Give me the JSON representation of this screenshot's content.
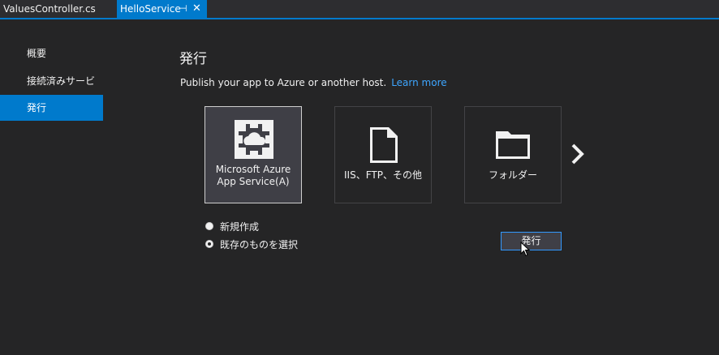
{
  "tabs": [
    {
      "label": "ValuesController.cs",
      "active": false
    },
    {
      "label": "HelloService",
      "active": true
    }
  ],
  "tab_icons": {
    "pin": "pin-icon",
    "close": "close-icon"
  },
  "sidebar": {
    "items": [
      {
        "label": "概要",
        "active": false
      },
      {
        "label": "接続済みサービス",
        "active": false
      },
      {
        "label": "発行",
        "active": true
      }
    ]
  },
  "main": {
    "title": "発行",
    "subtitle": "Publish your app to Azure or another host.",
    "learn_more": "Learn more",
    "targets": [
      {
        "line1": "Microsoft Azure",
        "line2": "App Service(A)",
        "icon": "azure-app-service-icon",
        "selected": true
      },
      {
        "line1": "IIS、FTP、その他",
        "icon": "file-icon",
        "selected": false
      },
      {
        "line1": "フォルダー",
        "icon": "folder-icon",
        "selected": false
      }
    ],
    "more_icon": "chevron-right-icon",
    "options": [
      {
        "label": "新規作成",
        "checked": false
      },
      {
        "label": "既存のものを選択",
        "checked": true
      }
    ],
    "publish_button": "発行"
  },
  "colors": {
    "accent": "#007acc",
    "background": "#252526",
    "link": "#3ea6ff"
  }
}
